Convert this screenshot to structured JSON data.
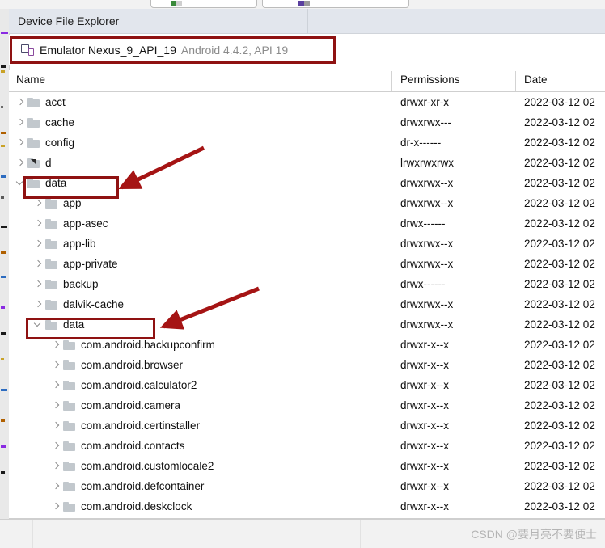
{
  "panel": {
    "title": "Device File Explorer"
  },
  "device": {
    "icon": "device-icon",
    "name": "Emulator Nexus_9_API_19",
    "details": "Android 4.4.2, API 19"
  },
  "table": {
    "columns": [
      "Name",
      "Permissions",
      "Date"
    ],
    "rows": [
      {
        "indent": 0,
        "expander": "collapsed",
        "icon": "folder-icon",
        "name": "acct",
        "permissions": "drwxr-xr-x",
        "date": "2022-03-12 02"
      },
      {
        "indent": 0,
        "expander": "collapsed",
        "icon": "folder-icon",
        "name": "cache",
        "permissions": "drwxrwx---",
        "date": "2022-03-12 02"
      },
      {
        "indent": 0,
        "expander": "collapsed",
        "icon": "folder-icon",
        "name": "config",
        "permissions": "dr-x------",
        "date": "2022-03-12 02"
      },
      {
        "indent": 0,
        "expander": "collapsed",
        "icon": "folder-link-icon",
        "name": "d",
        "permissions": "lrwxrwxrwx",
        "date": "2022-03-12 02"
      },
      {
        "indent": 0,
        "expander": "expanded",
        "icon": "folder-icon",
        "name": "data",
        "permissions": "drwxrwx--x",
        "date": "2022-03-12 02"
      },
      {
        "indent": 1,
        "expander": "collapsed",
        "icon": "folder-icon",
        "name": "app",
        "permissions": "drwxrwx--x",
        "date": "2022-03-12 02"
      },
      {
        "indent": 1,
        "expander": "collapsed",
        "icon": "folder-icon",
        "name": "app-asec",
        "permissions": "drwx------",
        "date": "2022-03-12 02"
      },
      {
        "indent": 1,
        "expander": "collapsed",
        "icon": "folder-icon",
        "name": "app-lib",
        "permissions": "drwxrwx--x",
        "date": "2022-03-12 02"
      },
      {
        "indent": 1,
        "expander": "collapsed",
        "icon": "folder-icon",
        "name": "app-private",
        "permissions": "drwxrwx--x",
        "date": "2022-03-12 02"
      },
      {
        "indent": 1,
        "expander": "collapsed",
        "icon": "folder-icon",
        "name": "backup",
        "permissions": "drwx------",
        "date": "2022-03-12 02"
      },
      {
        "indent": 1,
        "expander": "collapsed",
        "icon": "folder-icon",
        "name": "dalvik-cache",
        "permissions": "drwxrwx--x",
        "date": "2022-03-12 02"
      },
      {
        "indent": 1,
        "expander": "expanded",
        "icon": "folder-icon",
        "name": "data",
        "permissions": "drwxrwx--x",
        "date": "2022-03-12 02"
      },
      {
        "indent": 2,
        "expander": "collapsed",
        "icon": "folder-icon",
        "name": "com.android.backupconfirm",
        "permissions": "drwxr-x--x",
        "date": "2022-03-12 02"
      },
      {
        "indent": 2,
        "expander": "collapsed",
        "icon": "folder-icon",
        "name": "com.android.browser",
        "permissions": "drwxr-x--x",
        "date": "2022-03-12 02"
      },
      {
        "indent": 2,
        "expander": "collapsed",
        "icon": "folder-icon",
        "name": "com.android.calculator2",
        "permissions": "drwxr-x--x",
        "date": "2022-03-12 02"
      },
      {
        "indent": 2,
        "expander": "collapsed",
        "icon": "folder-icon",
        "name": "com.android.camera",
        "permissions": "drwxr-x--x",
        "date": "2022-03-12 02"
      },
      {
        "indent": 2,
        "expander": "collapsed",
        "icon": "folder-icon",
        "name": "com.android.certinstaller",
        "permissions": "drwxr-x--x",
        "date": "2022-03-12 02"
      },
      {
        "indent": 2,
        "expander": "collapsed",
        "icon": "folder-icon",
        "name": "com.android.contacts",
        "permissions": "drwxr-x--x",
        "date": "2022-03-12 02"
      },
      {
        "indent": 2,
        "expander": "collapsed",
        "icon": "folder-icon",
        "name": "com.android.customlocale2",
        "permissions": "drwxr-x--x",
        "date": "2022-03-12 02"
      },
      {
        "indent": 2,
        "expander": "collapsed",
        "icon": "folder-icon",
        "name": "com.android.defcontainer",
        "permissions": "drwxr-x--x",
        "date": "2022-03-12 02"
      },
      {
        "indent": 2,
        "expander": "collapsed",
        "icon": "folder-icon",
        "name": "com.android.deskclock",
        "permissions": "drwxr-x--x",
        "date": "2022-03-12 02"
      }
    ]
  },
  "annotations": {
    "color": "#8f1212",
    "boxes": [
      "device-selector",
      "data-row-top-level",
      "data-row-nested"
    ],
    "arrows": [
      "arrow-to-data-top-level",
      "arrow-to-data-nested"
    ]
  },
  "watermark": {
    "text": "CSDN @要月亮不要便士"
  }
}
